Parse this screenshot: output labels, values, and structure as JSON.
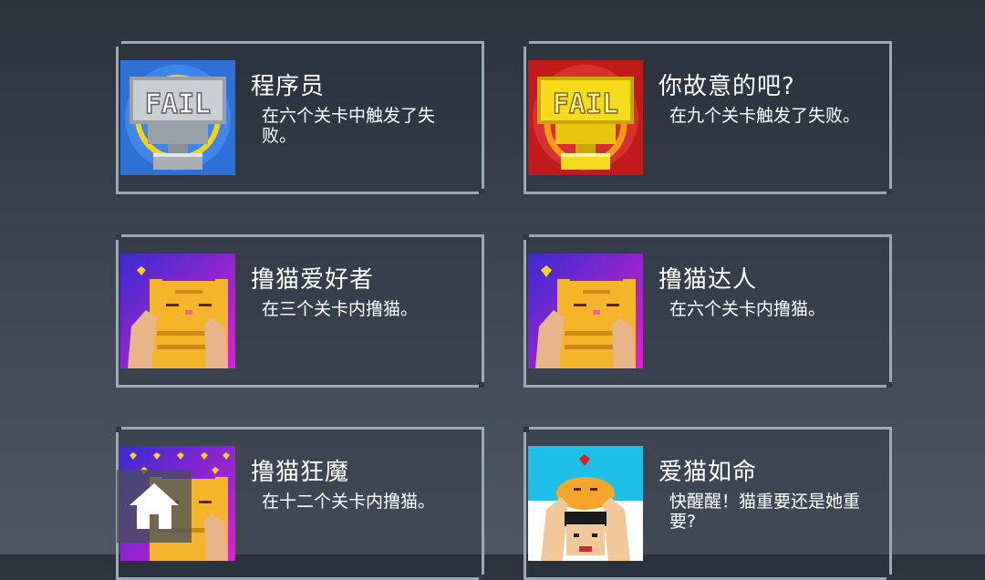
{
  "achievements": [
    {
      "title": "程序员",
      "desc": "在六个关卡中触发了失败。",
      "icon": "silver-fail-trophy-icon"
    },
    {
      "title": "你故意的吧?",
      "desc": "在九个关卡触发了失败。",
      "icon": "gold-fail-trophy-icon"
    },
    {
      "title": "撸猫爱好者",
      "desc": "在三个关卡内撸猫。",
      "icon": "petting-cat-icon"
    },
    {
      "title": "撸猫达人",
      "desc": "在六个关卡内撸猫。",
      "icon": "petting-cat-icon"
    },
    {
      "title": "撸猫狂魔",
      "desc": "在十二个关卡内撸猫。",
      "icon": "petting-cat-hearts-icon"
    },
    {
      "title": "爱猫如命",
      "desc": "快醒醒！猫重要还是她重要?",
      "icon": "cat-on-head-icon"
    }
  ],
  "badge_text": {
    "fail": "FAIL"
  },
  "colors": {
    "card_border": "#9aa9b3",
    "text": "#ffffff"
  },
  "home_button_icon": "home-icon"
}
